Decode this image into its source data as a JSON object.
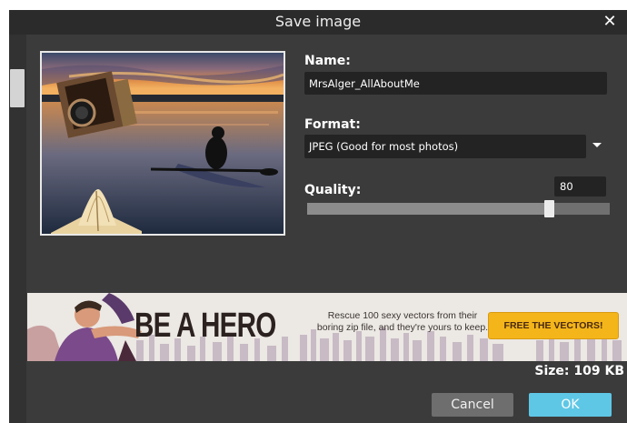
{
  "dialog": {
    "title": "Save image",
    "close_glyph": "✕",
    "close_icon": "close-icon"
  },
  "form": {
    "name_label": "Name:",
    "name_value": "MrsAlger_AllAboutMe",
    "format_label": "Format:",
    "format_value": "JPEG (Good for most photos)",
    "quality_label": "Quality:",
    "quality_value": "80",
    "quality_slider_value": 80,
    "quality_slider_max": 100
  },
  "ad_banner": {
    "headline": "BE A HERO",
    "description": "Rescue 100 sexy vectors from their boring zip file, and they're yours to keep.",
    "button_label": "FREE THE VECTORS!"
  },
  "footer": {
    "size_text": "Size: 109 KB",
    "cancel_label": "Cancel",
    "ok_label": "OK"
  },
  "colors": {
    "dialog_bg": "#3b3b3b",
    "ok_button": "#5fc7e6",
    "cancel_button": "#6e6e6e",
    "banner_button": "#f3b51a"
  }
}
